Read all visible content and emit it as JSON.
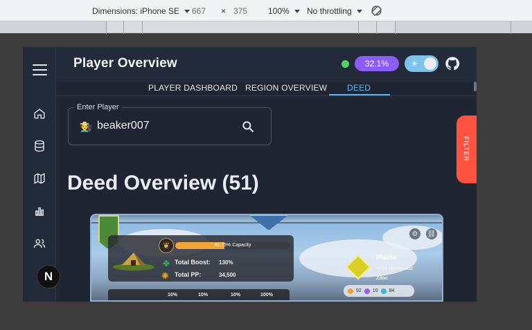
{
  "devtools": {
    "dimensions_label": "Dimensions: iPhone SE",
    "width": "667",
    "times": "×",
    "height": "375",
    "zoom": "100%",
    "throttling": "No throttling"
  },
  "header": {
    "title": "Player Overview",
    "percent_badge": "32.1%",
    "theme_icon": "sun-icon",
    "github_icon": "github-icon"
  },
  "tabs": [
    {
      "label": "PLAYER DASHBOARD",
      "active": false
    },
    {
      "label": "REGION OVERVIEW",
      "active": false
    },
    {
      "label": "DEED",
      "active": true
    }
  ],
  "sidebar": {
    "menu_icon": "hamburger-icon",
    "items": [
      {
        "icon": "home-icon"
      },
      {
        "icon": "database-icon"
      },
      {
        "icon": "map-icon"
      },
      {
        "icon": "bar-chart-icon"
      },
      {
        "icon": "users-icon"
      }
    ],
    "badge_letter": "N"
  },
  "player_search": {
    "label": "Enter Player",
    "avatar": "🧑‍🌾",
    "value": "beaker007"
  },
  "filter_tab": {
    "label": "FILTER"
  },
  "deed_overview": {
    "title": "Deed Overview (51)"
  },
  "deed_card": {
    "capacity_text": "42.75% Capacity",
    "capacity_fraction": 0.4275,
    "total_boost_label": "Total Boost:",
    "total_boost_value": "130%",
    "total_pp_label": "Total PP:",
    "total_pp_value": "34,500",
    "terrain": "Plains",
    "region": "Wild Northeast",
    "tract": "Zilac",
    "resources": [
      "92",
      "10",
      "84"
    ],
    "lower_percents": [
      "10%",
      "10%",
      "10%",
      "100%"
    ],
    "colors": {
      "capacity_fill": "#f1a43a",
      "boost": "#38c26a",
      "terrain": "#d8d028"
    }
  }
}
